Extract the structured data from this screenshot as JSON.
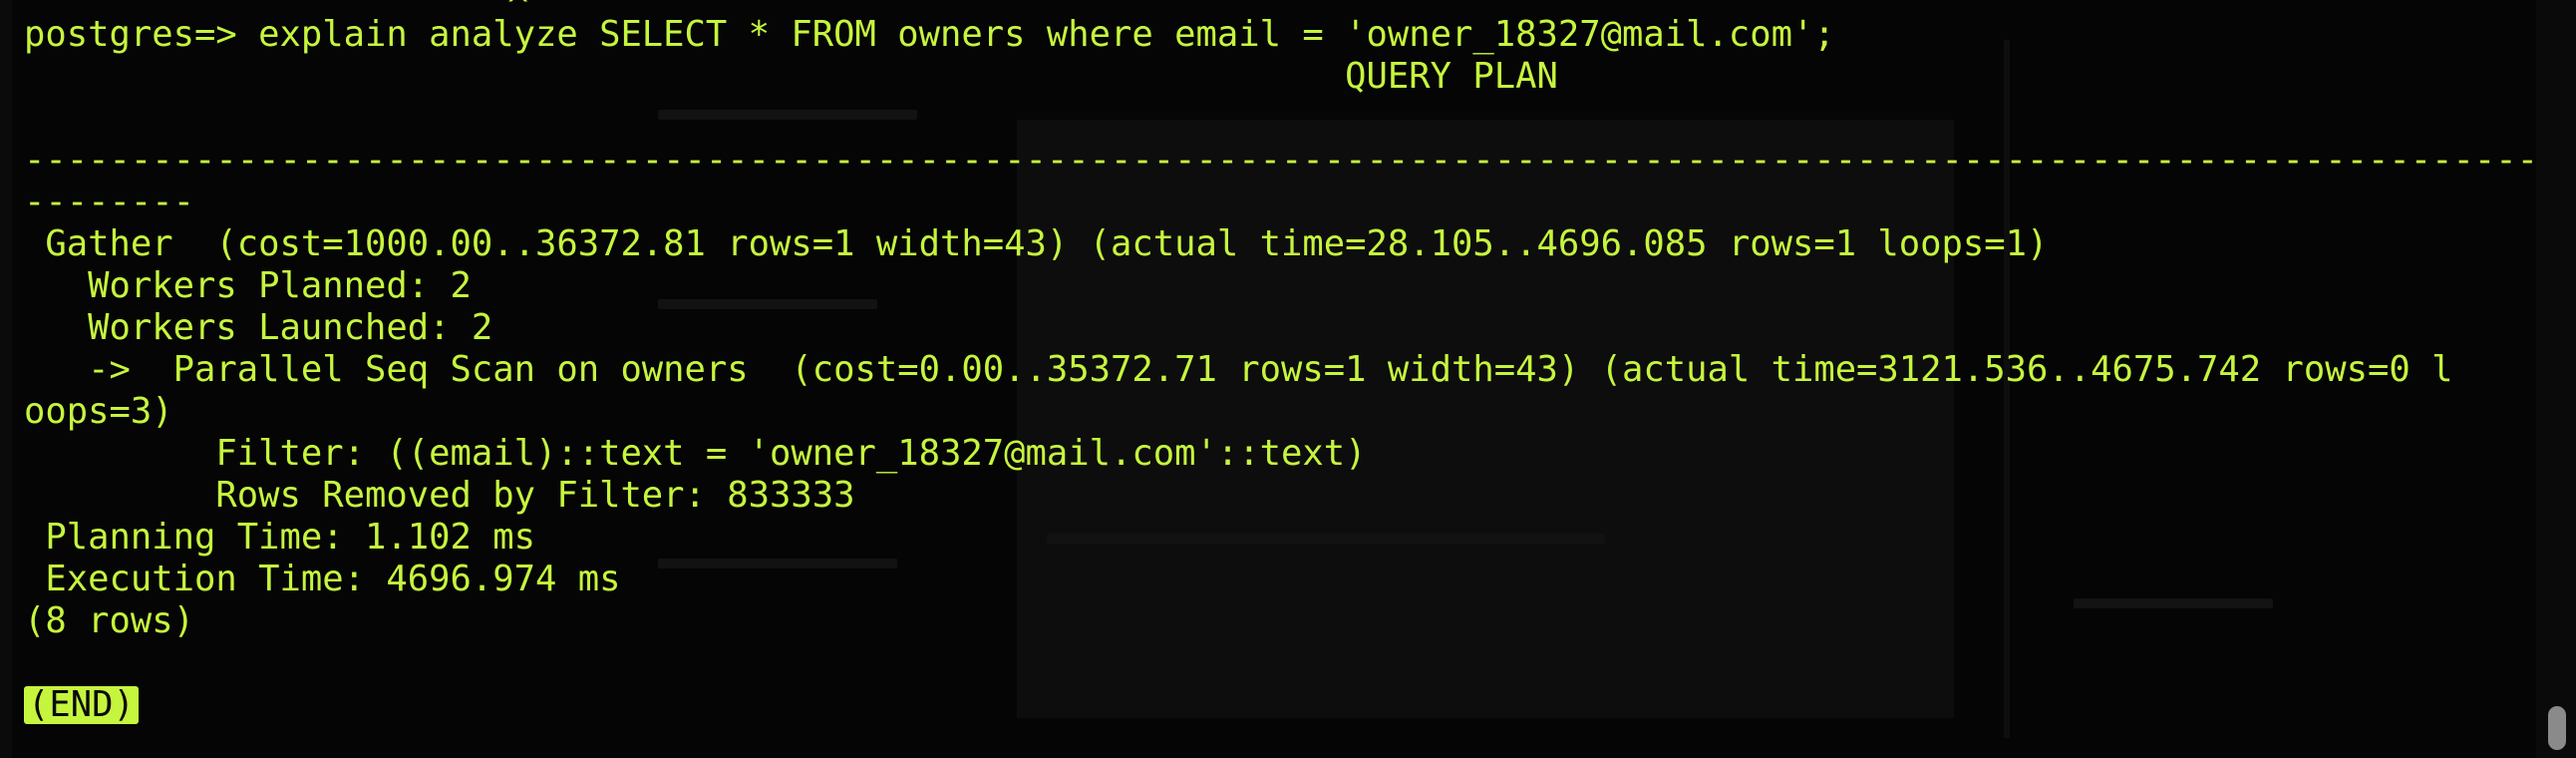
{
  "terminal": {
    "colors": {
      "background": "#050505",
      "text": "#c6f53e",
      "end_marker_bg": "#c6f53e"
    },
    "caret_fragment": "^",
    "lines": [
      "postgres=> explain analyze SELECT * FROM owners where email = 'owner_18327@mail.com';",
      "                                                              QUERY PLAN",
      "",
      "----------------------------------------------------------------------------------------------------------------------",
      "--------",
      " Gather  (cost=1000.00..36372.81 rows=1 width=43) (actual time=28.105..4696.085 rows=1 loops=1)",
      "   Workers Planned: 2",
      "   Workers Launched: 2",
      "   ->  Parallel Seq Scan on owners  (cost=0.00..35372.71 rows=1 width=43) (actual time=3121.536..4675.742 rows=0 l",
      "oops=3)",
      "         Filter: ((email)::text = 'owner_18327@mail.com'::text)",
      "         Rows Removed by Filter: 833333",
      " Planning Time: 1.102 ms",
      " Execution Time: 4696.974 ms",
      "(8 rows)",
      ""
    ],
    "end_marker": "(END)"
  }
}
